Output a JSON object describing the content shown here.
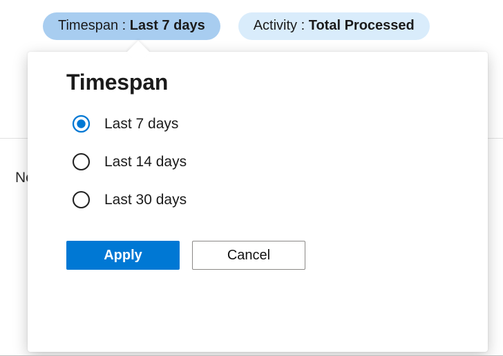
{
  "filters": {
    "timespan": {
      "label": "Timespan : ",
      "value": "Last 7 days"
    },
    "activity": {
      "label": "Activity : ",
      "value": "Total Processed"
    }
  },
  "background": {
    "truncated_text": "No"
  },
  "popover": {
    "title": "Timespan",
    "options": [
      {
        "label": "Last 7 days",
        "selected": true
      },
      {
        "label": "Last 14 days",
        "selected": false
      },
      {
        "label": "Last 30 days",
        "selected": false
      }
    ],
    "apply_label": "Apply",
    "cancel_label": "Cancel"
  },
  "colors": {
    "accent": "#0078d4",
    "pill_active_bg": "#a8cdf0",
    "pill_inactive_bg": "#d9ecfb"
  }
}
